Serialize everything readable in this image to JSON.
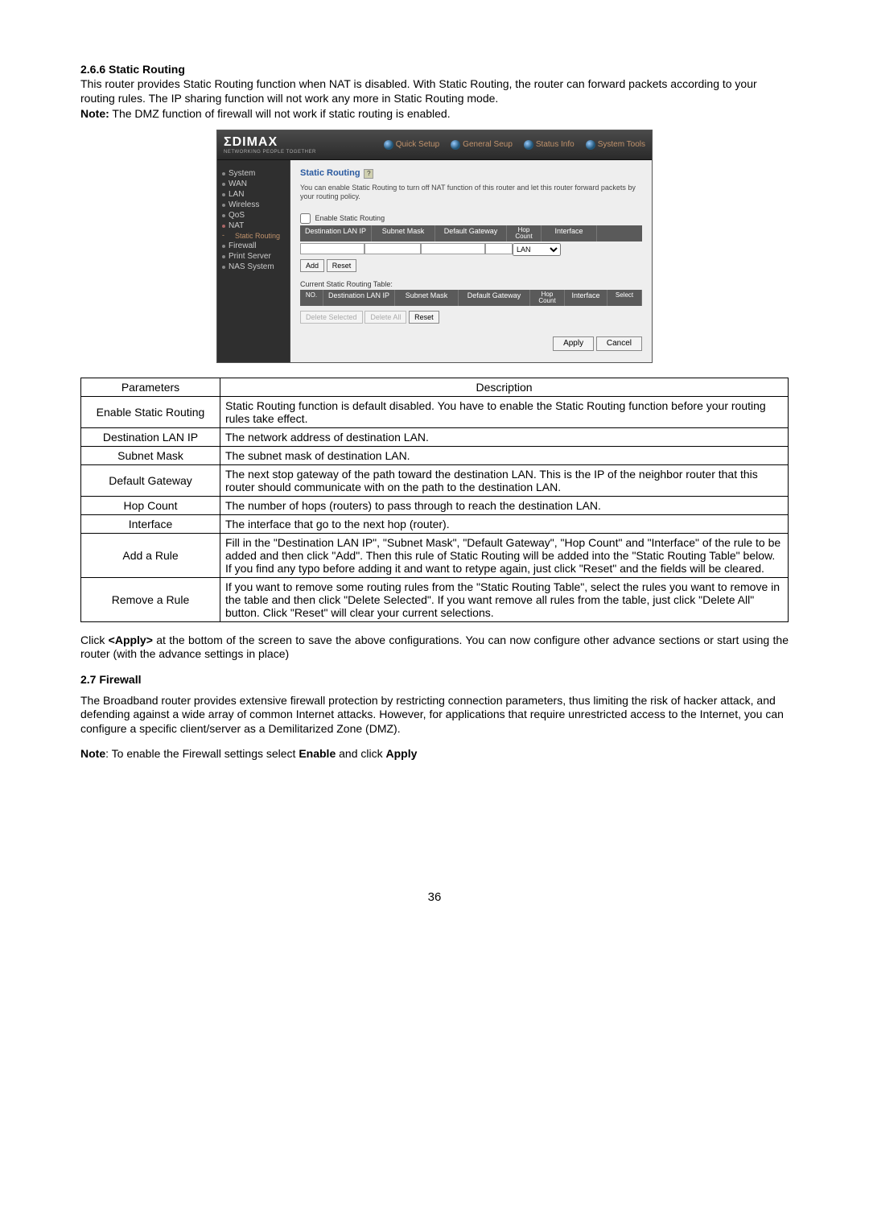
{
  "section1": {
    "heading": "2.6.6 Static Routing",
    "para1": "This router provides Static Routing function when NAT is disabled. With Static Routing, the router can forward packets according to your routing rules. The IP sharing function will not work any more in Static Routing mode.",
    "note_label": "Note:",
    "note_text": " The DMZ function of firewall will not work if static routing is enabled."
  },
  "router": {
    "logo": "ΣDIMAX",
    "logo_tag": "NETWORKING PEOPLE TOGETHER",
    "nav": {
      "quick": "Quick Setup",
      "general": "General Seup",
      "status": "Status Info",
      "tools": "System Tools"
    },
    "side": {
      "system": "System",
      "wan": "WAN",
      "lan": "LAN",
      "wireless": "Wireless",
      "qos": "QoS",
      "nat": "NAT",
      "static": "Static Routing",
      "firewall": "Firewall",
      "print": "Print Server",
      "nas": "NAS System"
    },
    "main": {
      "title": "Static Routing",
      "help": "?",
      "desc": "You can enable Static Routing to turn off NAT function of this router and let this router forward packets by your routing policy.",
      "enable": "Enable Static Routing",
      "hdr_dest": "Destination LAN IP",
      "hdr_mask": "Subnet Mask",
      "hdr_gw": "Default Gateway",
      "hdr_hop": "Hop Count",
      "hdr_if": "Interface",
      "if_sel": "LAN",
      "btn_add": "Add",
      "btn_reset": "Reset",
      "table_caption": "Current Static Routing Table:",
      "hdr_no": "NO.",
      "hdr_sel": "Select",
      "btn_delsel": "Delete Selected",
      "btn_delall": "Delete All",
      "btn_reset2": "Reset",
      "btn_apply": "Apply",
      "btn_cancel": "Cancel"
    }
  },
  "params_table": {
    "h1": "Parameters",
    "h2": "Description",
    "rows": [
      {
        "p": "Enable Static Routing",
        "d": "Static Routing function is default disabled. You have to enable the Static Routing function before your routing rules take effect."
      },
      {
        "p": "Destination LAN IP",
        "d": "The network address of destination LAN."
      },
      {
        "p": "Subnet Mask",
        "d": "The subnet mask of destination LAN."
      },
      {
        "p": "Default Gateway",
        "d": "The next stop gateway of the path toward the destination LAN. This is the IP of the neighbor router that this router should communicate with on the path to the destination LAN."
      },
      {
        "p": "Hop Count",
        "d": "The number of hops (routers) to pass through to reach the destination LAN."
      },
      {
        "p": "Interface",
        "d": "The interface that go to the next hop (router)."
      },
      {
        "p": "Add a Rule",
        "d": "Fill in the \"Destination LAN IP\", \"Subnet Mask\", \"Default Gateway\", \"Hop Count\" and \"Interface\" of the rule to be added and then click \"Add\". Then this rule of Static Routing will be added into the \"Static Routing Table\" below. If you find any typo before adding it and want to retype again, just click \"Reset\" and the fields will be cleared."
      },
      {
        "p": "Remove a Rule",
        "d": "If you want to remove some routing rules from the \"Static Routing Table\", select the rules you want to remove in the table and then click \"Delete Selected\". If you want remove all rules from the table, just click \"Delete All\" button. Click \"Reset\" will clear your current selections."
      }
    ]
  },
  "after_table_prefix": "Click ",
  "after_table_apply": "<Apply>",
  "after_table_suffix": " at the bottom of the screen to save the above configurations. You can now configure other advance sections or start using the router (with the advance settings in place)",
  "section2": {
    "heading": "2.7 Firewall",
    "para1": "The Broadband router provides extensive firewall protection by restricting connection parameters, thus limiting the risk of hacker attack, and defending against a wide array of common Internet attacks. However, for applications that require unrestricted access to the Internet, you can configure a specific client/server as a Demilitarized Zone (DMZ).",
    "note_label": "Note",
    "note_mid": ": To enable the Firewall settings select ",
    "note_enable": "Enable",
    "note_and": " and click ",
    "note_apply": "Apply"
  },
  "page_number": "36"
}
